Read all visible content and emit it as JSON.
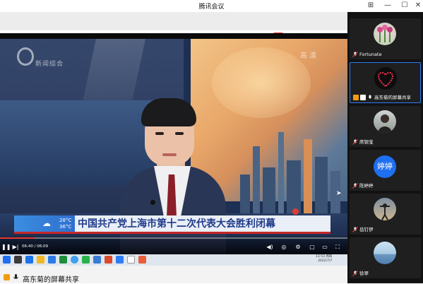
{
  "app": {
    "title": "腾讯会议"
  },
  "window_controls": {
    "pin": "⊞",
    "minimize": "—",
    "maximize": "☐",
    "close": "✕"
  },
  "video": {
    "channel_name": "新闻综合",
    "hd_mark": "高清",
    "headline": "中国共产党上海市第十二次代表大会胜利闭幕",
    "weather": {
      "high": "28°C",
      "low": "36°C"
    },
    "time": "06:40 / 06:09",
    "progress_fraction": 0.1
  },
  "taskbar": {
    "clock_time": "13:53 周四",
    "clock_date": "2022/7/7"
  },
  "share_label": {
    "text": "高东菊的屏幕共享"
  },
  "participants": [
    {
      "name": "Fortunate",
      "avatar": "flowers"
    },
    {
      "name": "高东菊的屏幕共享",
      "avatar": "heart",
      "active": true
    },
    {
      "name": "席银宝",
      "avatar": "man"
    },
    {
      "name": "陈婷婷",
      "avatar": "text",
      "avatar_text": "婷婷"
    },
    {
      "name": "岳钉伊",
      "avatar": "silhouette"
    },
    {
      "name": "徐翠",
      "avatar": "sea"
    }
  ],
  "colors": {
    "accent": "#2e7cf6",
    "headline": "#1e3a8a",
    "mic_off": "#e53935",
    "avatar_blue": "#1e6ff1"
  }
}
